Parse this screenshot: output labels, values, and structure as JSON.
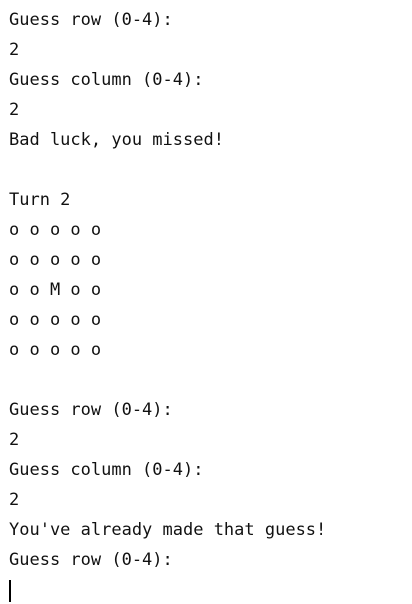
{
  "console": {
    "lines": [
      "Guess row (0-4):",
      "2",
      "Guess column (0-4):",
      "2",
      "Bad luck, you missed!",
      "",
      "Turn 2",
      "o o o o o",
      "o o o o o",
      "o o M o o",
      "o o o o o",
      "o o o o o",
      "",
      "Guess row (0-4):",
      "2",
      "Guess column (0-4):",
      "2",
      "You've already made that guess!",
      "Guess row (0-4):"
    ],
    "input_value": ""
  }
}
